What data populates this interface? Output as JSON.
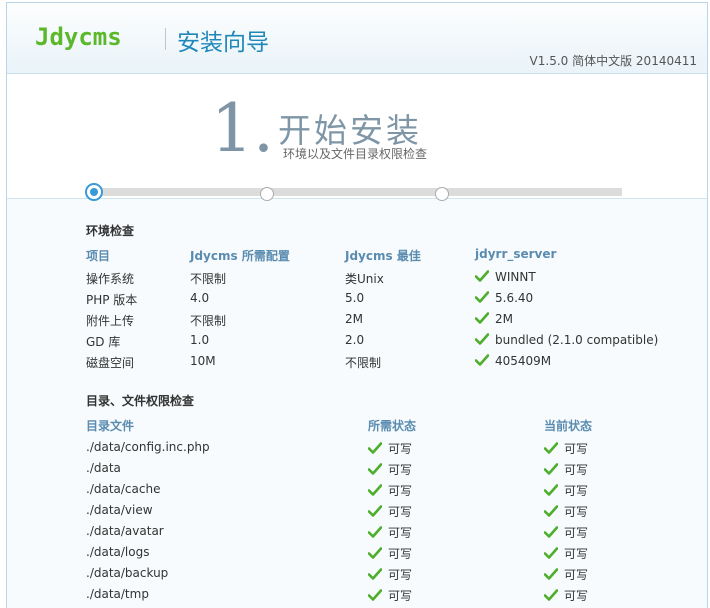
{
  "header": {
    "logo": "Jdycms",
    "title": "安装向导",
    "version": "V1.5.0 简体中文版 20140411"
  },
  "step": {
    "number": "1.",
    "title": "开始安装",
    "subtitle": "环境以及文件目录权限检查",
    "current": 1,
    "total": 3
  },
  "env": {
    "title": "环境检查",
    "headers": [
      "项目",
      "Jdycms 所需配置",
      "Jdycms 最佳",
      "jdyrr_server"
    ],
    "rows": [
      {
        "item": "操作系统",
        "required": "不限制",
        "best": "类Unix",
        "current": "WINNT"
      },
      {
        "item": "PHP 版本",
        "required": "4.0",
        "best": "5.0",
        "current": "5.6.40"
      },
      {
        "item": "附件上传",
        "required": "不限制",
        "best": "2M",
        "current": "2M"
      },
      {
        "item": "GD 库",
        "required": "1.0",
        "best": "2.0",
        "current": "bundled (2.1.0 compatible)"
      },
      {
        "item": "磁盘空间",
        "required": "10M",
        "best": "不限制",
        "current": "405409M"
      }
    ]
  },
  "dirs": {
    "title": "目录、文件权限检查",
    "headers": [
      "目录文件",
      "所需状态",
      "当前状态"
    ],
    "rows": [
      {
        "path": "./data/config.inc.php",
        "required": "可写",
        "current": "可写"
      },
      {
        "path": "./data",
        "required": "可写",
        "current": "可写"
      },
      {
        "path": "./data/cache",
        "required": "可写",
        "current": "可写"
      },
      {
        "path": "./data/view",
        "required": "可写",
        "current": "可写"
      },
      {
        "path": "./data/avatar",
        "required": "可写",
        "current": "可写"
      },
      {
        "path": "./data/logs",
        "required": "可写",
        "current": "可写"
      },
      {
        "path": "./data/backup",
        "required": "可写",
        "current": "可写"
      },
      {
        "path": "./data/tmp",
        "required": "可写",
        "current": "可写"
      }
    ]
  },
  "colors": {
    "accent": "#1f87b9",
    "logo": "#5cb82b",
    "check": "#4cae2b",
    "header_text": "#5a8cb0"
  }
}
